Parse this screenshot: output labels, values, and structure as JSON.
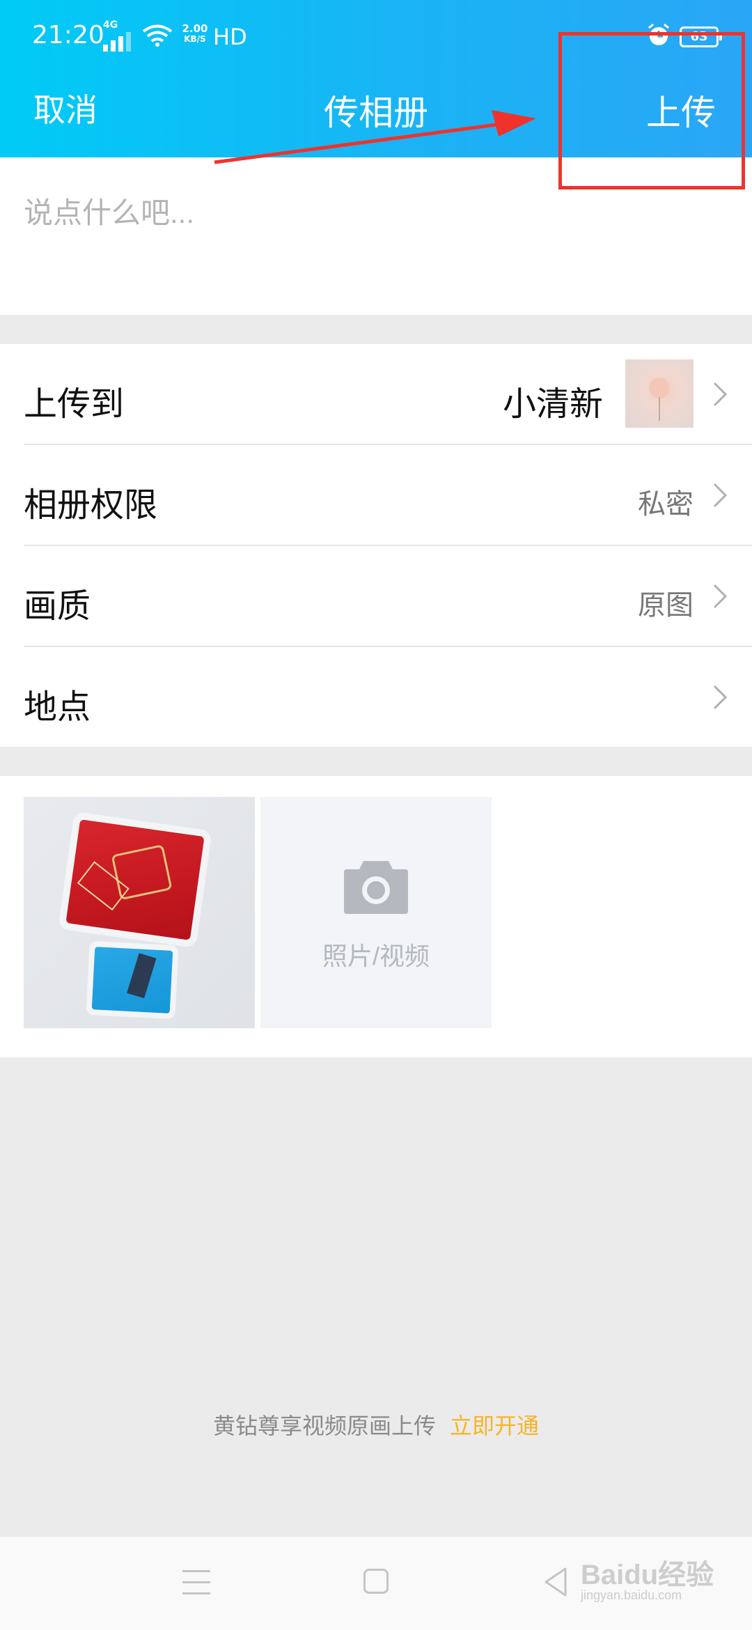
{
  "status_bar": {
    "time": "21:20",
    "network_label": "4G",
    "speed_value": "2.00",
    "speed_unit": "KB/S",
    "hd_label": "HD",
    "battery": "63"
  },
  "nav": {
    "cancel_label": "取消",
    "title": "传相册",
    "upload_label": "上传"
  },
  "compose": {
    "placeholder": "说点什么吧...",
    "value": ""
  },
  "settings": [
    {
      "label": "上传到",
      "value": "小清新"
    },
    {
      "label": "相册权限",
      "value": "私密"
    },
    {
      "label": "画质",
      "value": "原图"
    },
    {
      "label": "地点",
      "value": ""
    }
  ],
  "media": {
    "add_label": "照片/视频",
    "photo_count": 1
  },
  "promo": {
    "text": "黄钻尊享视频原画上传",
    "link": "立即开通"
  },
  "watermark": {
    "main": "Baidu经验",
    "sub": "jingyan.baidu.com"
  },
  "colors": {
    "header_start": "#00cbf6",
    "header_end": "#2aa6f6",
    "promo_link": "#f6b42a",
    "annotation": "#f0322c"
  },
  "icons": {
    "signal": "signal-icon",
    "wifi": "wifi-icon",
    "alarm": "alarm-icon",
    "battery": "battery-icon",
    "chevron": "chevron-right-icon",
    "camera": "camera-icon",
    "menu": "menu-icon",
    "home": "home-icon",
    "back": "back-icon"
  }
}
